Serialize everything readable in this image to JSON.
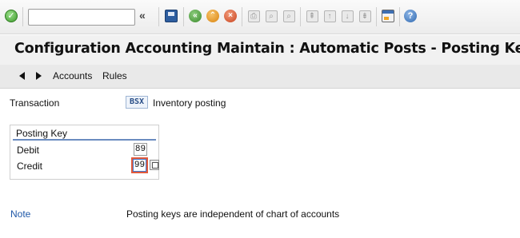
{
  "toolbar": {
    "command_field_value": "",
    "history_glyph": "«",
    "icons": [
      "ok-icon",
      "save-icon",
      "back-icon",
      "exit-icon",
      "cancel-icon",
      "print-icon",
      "find-icon",
      "find-next-icon",
      "first-page-icon",
      "prev-page-icon",
      "next-page-icon",
      "last-page-icon",
      "layout-icon",
      "help-icon"
    ]
  },
  "title": "Configuration Accounting Maintain : Automatic Posts - Posting Keys",
  "app_toolbar": {
    "accounts_label": "Accounts",
    "rules_label": "Rules"
  },
  "transaction": {
    "label": "Transaction",
    "code": "BSX",
    "description": "Inventory posting"
  },
  "posting_key": {
    "title": "Posting Key",
    "debit_label": "Debit",
    "debit_value": "89",
    "credit_label": "Credit",
    "credit_value": "99"
  },
  "note": {
    "label": "Note",
    "text": "Posting keys are independent of chart of accounts"
  },
  "colors": {
    "title_bar": "#f1f1f1",
    "link": "#1f58a8",
    "group_line": "#6a8cc0",
    "focus_ring": "#e15a3c"
  }
}
